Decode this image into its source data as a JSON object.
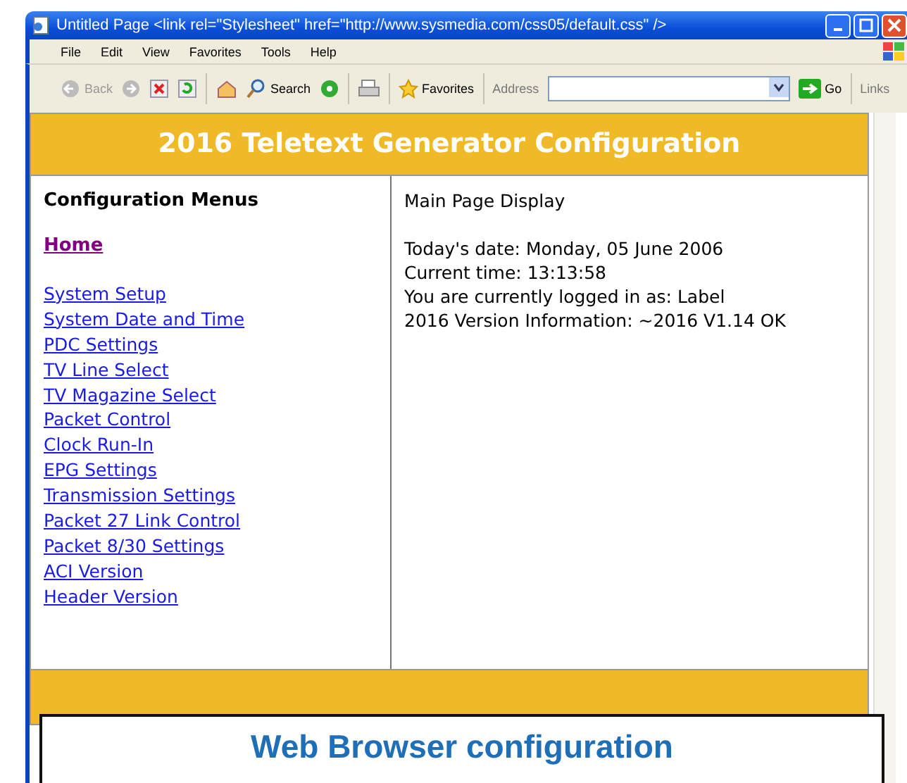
{
  "window": {
    "title": "Untitled Page <link rel=\"Stylesheet\" href=\"http://www.sysmedia.com/css05/default.css\" />"
  },
  "menu": [
    "File",
    "Edit",
    "View",
    "Favorites",
    "Tools",
    "Help"
  ],
  "toolbar": {
    "back": {
      "label": "Back",
      "disabled": true
    },
    "search": "Search",
    "favorites": "Favorites",
    "address_label": "Address",
    "go": "Go",
    "links": "Links"
  },
  "page": {
    "header": "2016 Teletext Generator Configuration",
    "sidebar": {
      "title": "Configuration Menus",
      "items": [
        {
          "label": "Home",
          "visited": true
        },
        {
          "label": "System Setup",
          "visited": false
        },
        {
          "label": "System Date and Time",
          "visited": false
        },
        {
          "label": "PDC Settings",
          "visited": false
        },
        {
          "label": "TV Line Select",
          "visited": false
        },
        {
          "label": "TV Magazine Select",
          "visited": false
        },
        {
          "label": "Packet Control",
          "visited": false
        },
        {
          "label": "Clock Run-In",
          "visited": false
        },
        {
          "label": "EPG Settings",
          "visited": false
        },
        {
          "label": "Transmission Settings",
          "visited": false
        },
        {
          "label": "Packet 27 Link Control",
          "visited": false
        },
        {
          "label": "Packet 8/30 Settings",
          "visited": false
        },
        {
          "label": "ACI Version",
          "visited": false
        },
        {
          "label": "Header Version",
          "visited": false
        }
      ]
    },
    "main": {
      "title": "Main Page Display",
      "lines": [
        "Today's date: Monday, 05 June 2006",
        "Current time: 13:13:58",
        "You are currently logged in as: Label",
        "2016 Version Information: ~2016 V1.14 OK"
      ]
    }
  },
  "caption": "Web Browser configuration"
}
